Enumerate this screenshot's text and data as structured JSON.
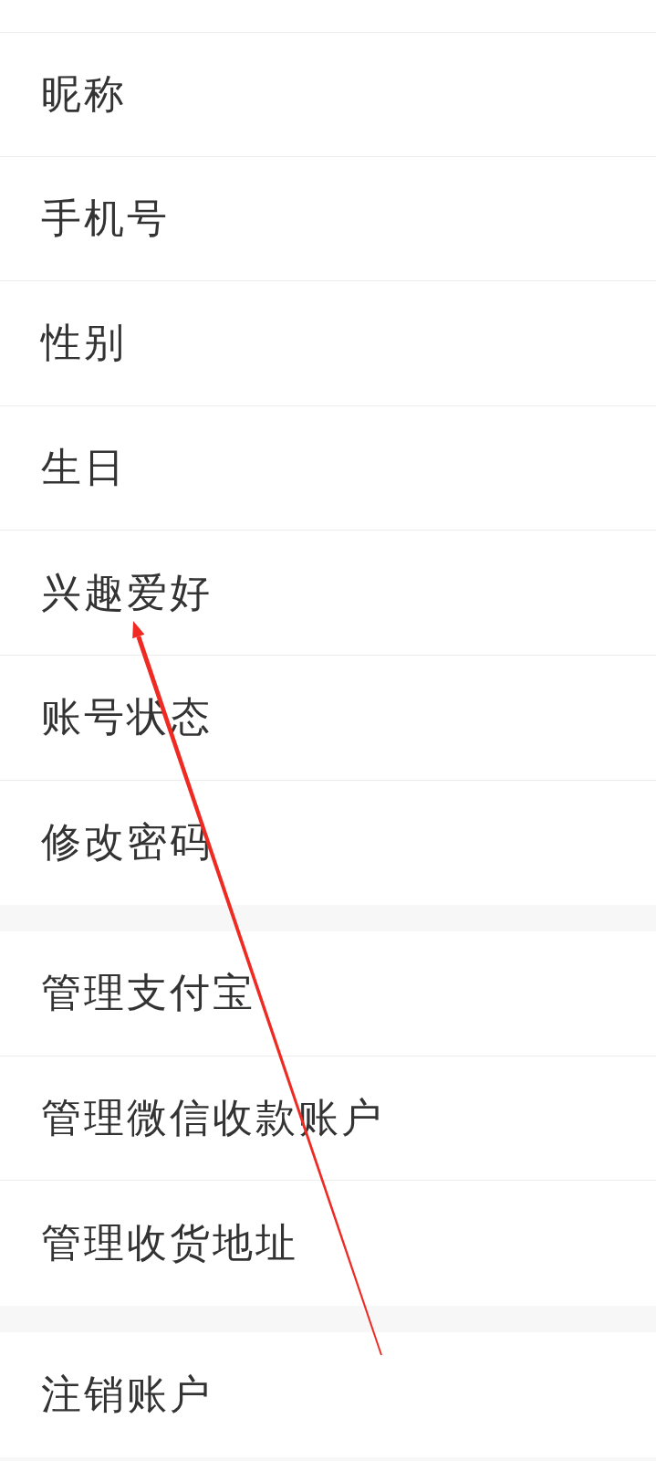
{
  "sections": [
    {
      "items": [
        {
          "label": "昵称"
        },
        {
          "label": "手机号"
        },
        {
          "label": "性别"
        },
        {
          "label": "生日"
        },
        {
          "label": "兴趣爱好"
        },
        {
          "label": "账号状态"
        },
        {
          "label": "修改密码"
        }
      ]
    },
    {
      "items": [
        {
          "label": "管理支付宝"
        },
        {
          "label": "管理微信收款账户"
        },
        {
          "label": "管理收货地址"
        }
      ]
    },
    {
      "items": [
        {
          "label": "注销账户"
        }
      ]
    }
  ]
}
